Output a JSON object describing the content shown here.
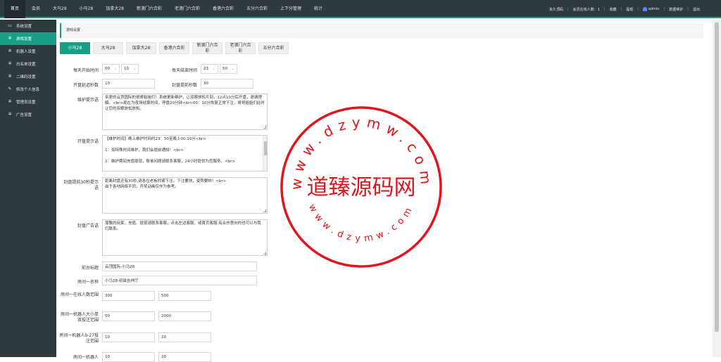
{
  "topnav": {
    "items": [
      "首页",
      "会员",
      "大马28",
      "小马28",
      "加拿大28",
      "新澳门六合彩",
      "老澳门六合彩",
      "香港六合彩",
      "五分六合彩",
      "上下分管理",
      "统计"
    ]
  },
  "topright": {
    "items": [
      "永久顶码",
      "会员在线人数：1",
      "收藏",
      "提现"
    ],
    "user": "admin",
    "extra": [
      "数据维护",
      "退出"
    ]
  },
  "sidebar": {
    "items": [
      {
        "label": "系统设置",
        "icon": "monitor-icon"
      },
      {
        "label": "游戏设置",
        "icon": "gear-icon"
      },
      {
        "label": "机器人设置",
        "icon": "gear-icon"
      },
      {
        "label": "白名单设置",
        "icon": "gear-icon"
      },
      {
        "label": "二维码设置",
        "icon": "gear-icon"
      },
      {
        "label": "修改个人信息",
        "icon": "pencil-icon"
      },
      {
        "label": "管理员设置",
        "icon": "gear-icon"
      },
      {
        "label": "广告设置",
        "icon": "gear-icon"
      }
    ]
  },
  "breadcrumb": "游戏设置",
  "tabs": [
    "小马28",
    "大马28",
    "加拿大28",
    "香港六合彩",
    "新澳门六合\n彩",
    "老澳门六合\n彩",
    "五分六合彩"
  ],
  "form": {
    "open_time": {
      "label": "每天开始时间",
      "hour": "00",
      "minute": "10"
    },
    "close_time": {
      "label": "每天结束时间",
      "hour": "23",
      "minute": "50"
    },
    "delay": {
      "label": "开盘延迟秒数",
      "value": "10"
    },
    "close_ahead": {
      "label": "封盘提前秒数",
      "value": "30"
    },
    "maintenance": {
      "label": "维护提示语",
      "value": "亲爱的云顶国际的哥哥姐姐们！系统更新维护，让双眼放松片刻，12点10分后开盘，谢谢理解。<br>现在为夜场结算时间，停盘20分钟<br>00：10分恢复正常下注，哥哥姐姐们此时让您的双眼放松放松。"
    },
    "open_tip": {
      "label": "开盘提示语",
      "value": "【维护时间】晚上维护时间约23：50至晚上00:10分<br>\n\n1：如特殊时间维护，我们会提前通知！<br>\n\n2：维护期间充值提现，账单问题请联系客服，24小时提供为您服务。<br>"
    },
    "pre_close": {
      "label": "封盘提前30秒提示语",
      "value": "距离封盘还有30秒,请各位老板抓紧下注。下注要快，姿势要帅！<br>\n由于各地网络不同，开奖动画仅作为参考。"
    },
    "close_ad": {
      "label": "封盘广告语",
      "value": "尊敬的玩家，充值、提现请联系客服，点击左边客服，或首页客服,有合作意向的也可以与我们联系。"
    },
    "platform": {
      "label": "前台标题",
      "value": "云顶国际-小马28"
    },
    "room1": {
      "label": "房间一名称",
      "value": "小马28-初级吉祥厅"
    },
    "online_range": {
      "label": "房间一在线人数范围",
      "min": "300",
      "max": "500"
    },
    "robot_big_small": {
      "label": "房间一机器人大小单双投注范围",
      "min": "50",
      "max": "2000"
    },
    "robot_0_27": {
      "label": "房间一机器人0-27投注范围",
      "min": "10",
      "max": "20"
    },
    "robot_next": {
      "label": "房间一机器人",
      "min": "10",
      "max": "20"
    }
  },
  "stamp": {
    "site": "www.dzymw.com",
    "name": "道臻源码网",
    "color": "#e0161e"
  }
}
